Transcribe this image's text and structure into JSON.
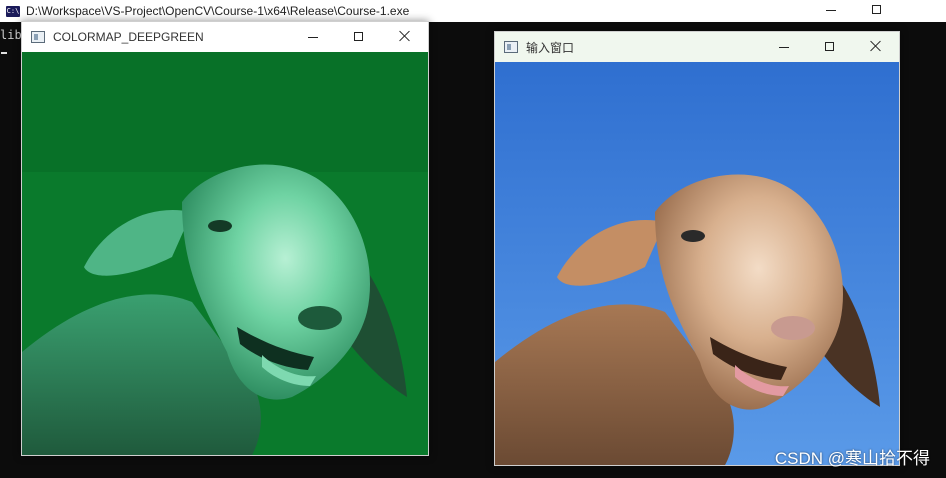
{
  "console": {
    "title": "D:\\Workspace\\VS-Project\\OpenCV\\Course-1\\x64\\Release\\Course-1.exe",
    "icon": "console-app-icon",
    "icon_text": "C:\\",
    "partial_text": "lib"
  },
  "deepgreen_window": {
    "title": "COLORMAP_DEEPGREEN",
    "image_desc": "sheep-face-green-colormap",
    "palette": {
      "background": "#0a7a2c",
      "fur": "#5fcf9a",
      "shadow": "#1e4f33"
    }
  },
  "input_window": {
    "title": "输入窗口",
    "image_desc": "sheep-face-original",
    "palette": {
      "sky": "#3e7fd8",
      "fur": "#d2a989",
      "shadow": "#6b4a33"
    }
  },
  "watermark": "CSDN @寒山拾不得"
}
